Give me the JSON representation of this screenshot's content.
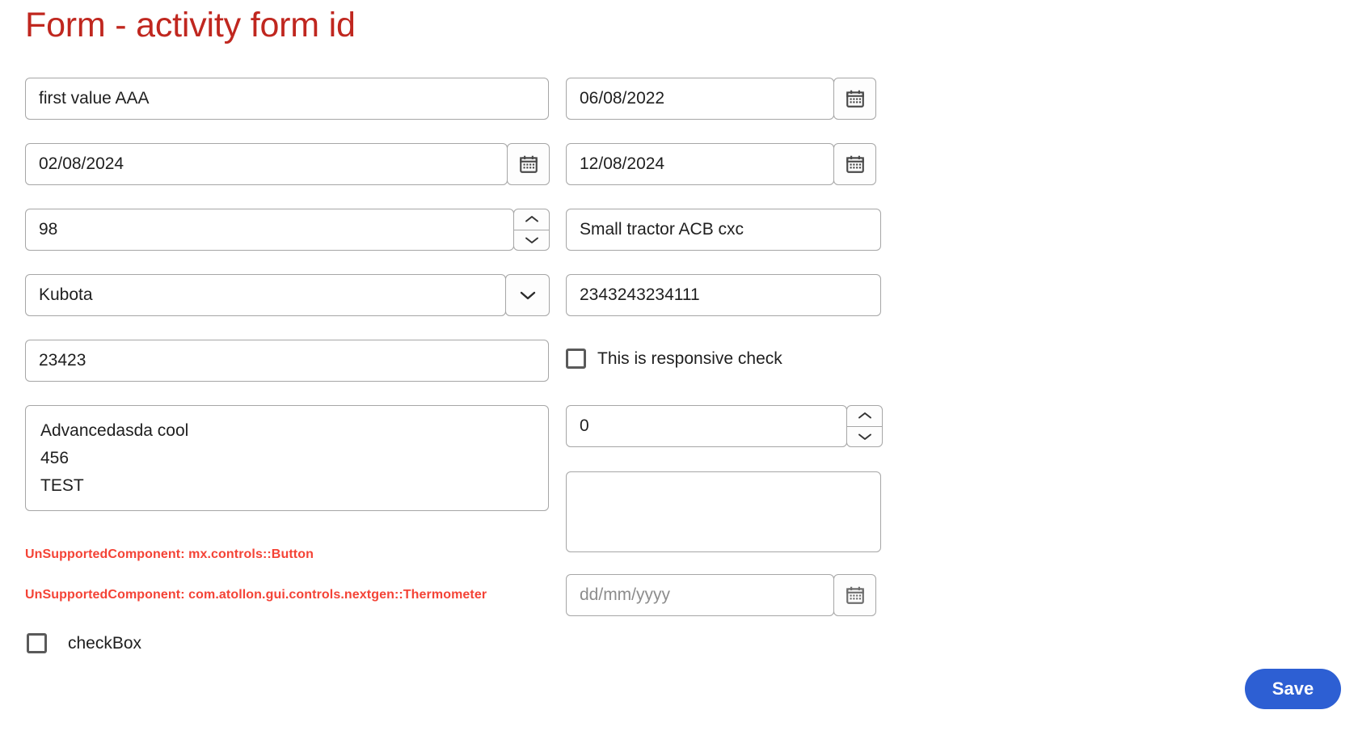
{
  "page": {
    "title": "Form - activity form id",
    "title_color": "#c0271f",
    "background": "#ffffff"
  },
  "fields": {
    "text_first": {
      "value": "first value AAA"
    },
    "date_created": {
      "value": "06/08/2022",
      "icon": "calendar-icon"
    },
    "date_from": {
      "value": "02/08/2024",
      "icon": "calendar-icon"
    },
    "date_to": {
      "value": "12/08/2024",
      "icon": "calendar-icon"
    },
    "number_quantity": {
      "value": "98",
      "icon_up": "chevron-up-icon",
      "icon_down": "chevron-down-icon"
    },
    "text_description": {
      "value": "Small tractor ACB cxc"
    },
    "select_brand": {
      "value": "Kubota",
      "icon": "chevron-down-icon"
    },
    "text_serial": {
      "value": "2343243234111"
    },
    "text_code": {
      "value": "23423"
    },
    "checkbox_responsive": {
      "label": "This is responsive check",
      "checked": false
    },
    "textarea_notes": {
      "value": "Advancedasda cool\n456\nTEST"
    },
    "number_counter": {
      "value": "0",
      "icon_up": "chevron-up-icon",
      "icon_down": "chevron-down-icon"
    },
    "textarea_empty": {
      "value": ""
    },
    "date_empty": {
      "value": "",
      "placeholder": "dd/mm/yyyy",
      "icon": "calendar-icon"
    },
    "checkbox_plain": {
      "label": "checkBox",
      "checked": false
    }
  },
  "errors": {
    "color": "#f44336",
    "items": [
      {
        "text": "UnSupportedComponent: mx.controls::Button"
      },
      {
        "text": "UnSupportedComponent: com.atollon.gui.controls.nextgen::Thermometer"
      }
    ]
  },
  "actions": {
    "save_label": "Save",
    "save_color": "#2d5fd3"
  }
}
